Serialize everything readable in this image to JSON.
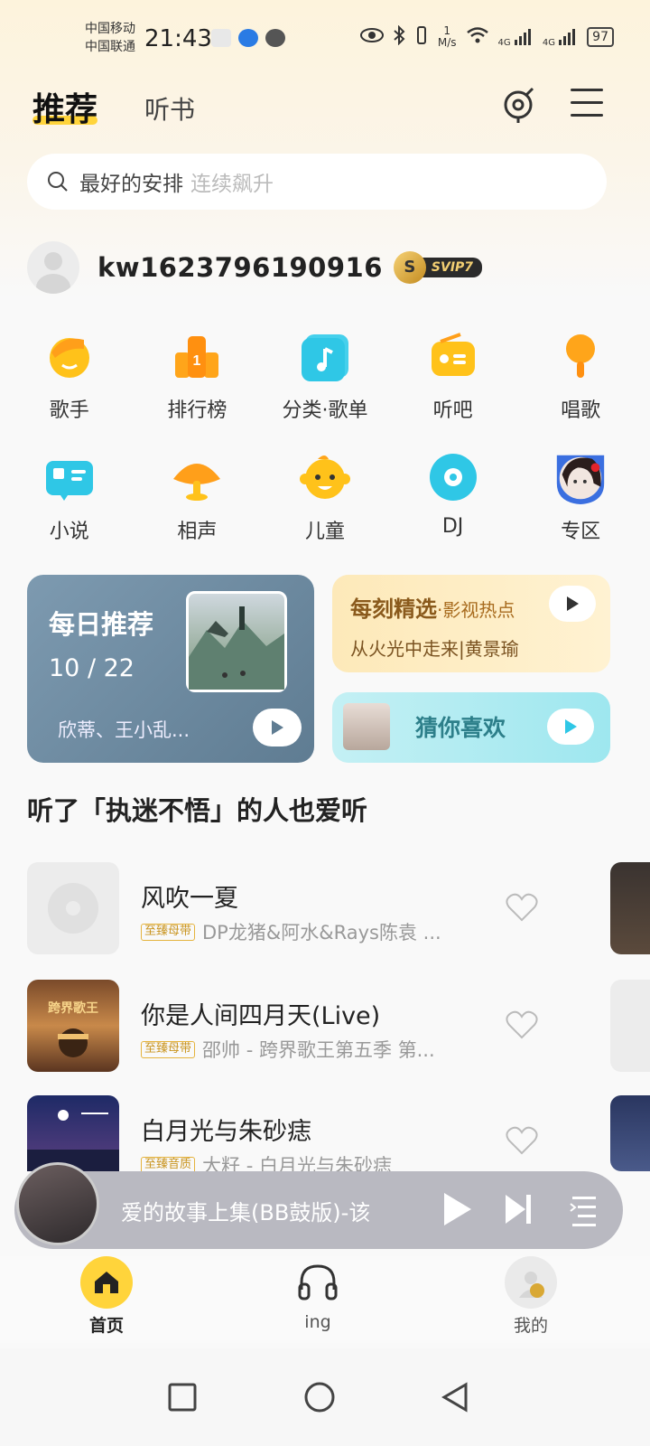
{
  "status_bar": {
    "carrier1": "中国移动",
    "carrier2": "中国联通",
    "time": "21:43",
    "net_speed_value": "1",
    "net_speed_unit": "M/s",
    "battery": "97",
    "signal1": "4G",
    "signal2": "4G"
  },
  "header": {
    "tab_recommend": "推荐",
    "tab_audiobook": "听书"
  },
  "search": {
    "main_text": "最好的安排",
    "sub_text": "连续飙升"
  },
  "user": {
    "username": "kw1623796190916",
    "vip_badge": "SVIP7",
    "vip_letter": "S"
  },
  "categories": [
    {
      "label": "歌手",
      "icon": "singer-icon"
    },
    {
      "label": "排行榜",
      "icon": "chart-icon"
    },
    {
      "label": "分类·歌单",
      "icon": "playlist-icon"
    },
    {
      "label": "听吧",
      "icon": "radio-icon"
    },
    {
      "label": "唱歌",
      "icon": "microphone-icon"
    },
    {
      "label": "小说",
      "icon": "book-icon"
    },
    {
      "label": "相声",
      "icon": "fan-icon"
    },
    {
      "label": "儿童",
      "icon": "kid-icon"
    },
    {
      "label": "DJ",
      "icon": "disc-icon"
    },
    {
      "label": "专区",
      "icon": "avatar-icon"
    }
  ],
  "chart_icon_digit": "1",
  "daily": {
    "title": "每日推荐",
    "date": "10 / 22",
    "artists": "欣蒂、王小乱..."
  },
  "pick": {
    "title": "每刻精选",
    "title_suffix": "·影视热点",
    "subtitle": "从火光中走来|黄景瑜"
  },
  "guess": {
    "title": "猜你喜欢"
  },
  "section": {
    "title": "听了「执迷不悟」的人也爱听"
  },
  "songs": [
    {
      "title": "风吹一夏",
      "tag": "至臻母带",
      "subtitle": "DP龙猪&阿水&Rays陈袁 ..."
    },
    {
      "title": "你是人间四月天(Live)",
      "tag": "至臻母带",
      "subtitle": "邵帅 - 跨界歌王第五季 第..."
    },
    {
      "title": "白月光与朱砂痣",
      "tag": "至臻音质",
      "subtitle": "大籽 - 白月光与朱砂痣"
    }
  ],
  "player": {
    "title": "爱的故事上集(BB鼓版)-该"
  },
  "bottom_nav": {
    "home": "首页",
    "ing": "ing",
    "mine": "我的"
  },
  "colors": {
    "accent_yellow": "#ffd43b",
    "icon_orange": "#ffb300",
    "icon_cyan": "#2fc7e6"
  }
}
